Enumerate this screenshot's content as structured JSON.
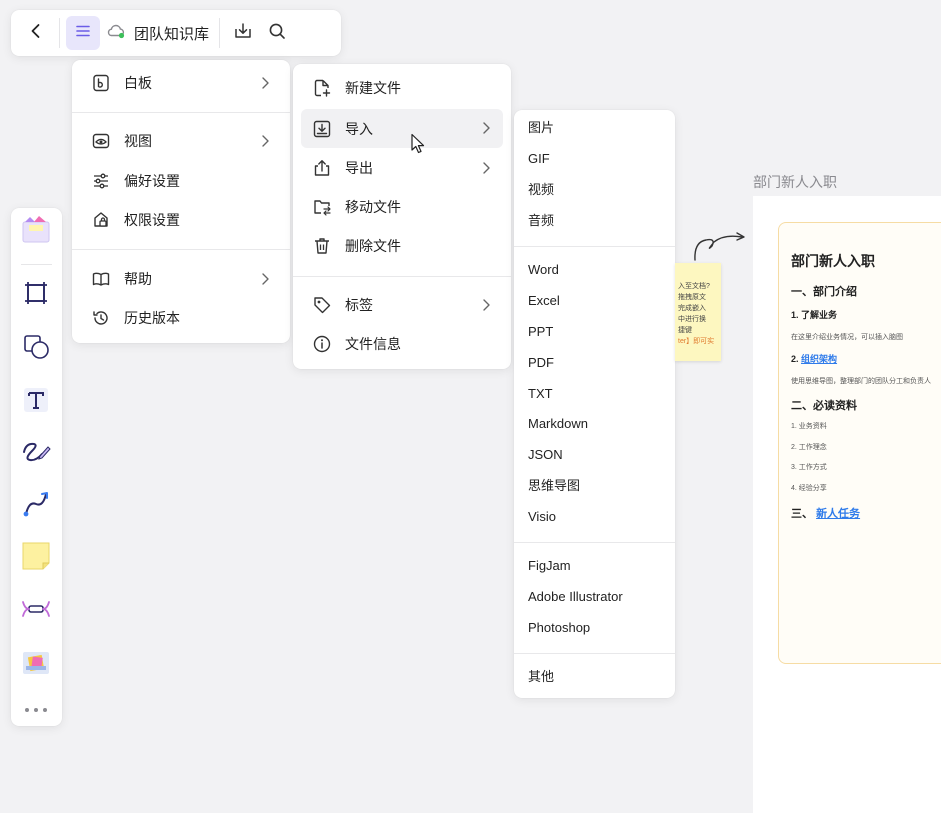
{
  "topbar": {
    "back_icon": "chevron-left-icon",
    "menu_icon": "hamburger-menu-icon",
    "cloud_icon": "cloud-synced-icon",
    "title": "团队知识库",
    "download_icon": "download-icon",
    "search_icon": "search-icon",
    "accent": "#6b5ce7"
  },
  "main_menu": {
    "items": [
      {
        "label": "白板",
        "icon": "whiteboard-icon",
        "has_submenu": true
      },
      {
        "label": "视图",
        "icon": "eye-icon",
        "has_submenu": true
      },
      {
        "label": "偏好设置",
        "icon": "sliders-icon",
        "has_submenu": false
      },
      {
        "label": "权限设置",
        "icon": "lock-icon",
        "has_submenu": false
      },
      {
        "label": "帮助",
        "icon": "book-icon",
        "has_submenu": true
      },
      {
        "label": "历史版本",
        "icon": "history-icon",
        "has_submenu": false
      }
    ]
  },
  "file_menu": {
    "items": [
      {
        "label": "新建文件",
        "icon": "new-file-icon",
        "has_submenu": false
      },
      {
        "label": "导入",
        "icon": "import-icon",
        "has_submenu": true,
        "active": true
      },
      {
        "label": "导出",
        "icon": "export-icon",
        "has_submenu": true
      },
      {
        "label": "移动文件",
        "icon": "move-folder-icon",
        "has_submenu": false
      },
      {
        "label": "删除文件",
        "icon": "trash-icon",
        "has_submenu": false
      },
      {
        "label": "标签",
        "icon": "tag-icon",
        "has_submenu": true
      },
      {
        "label": "文件信息",
        "icon": "info-icon",
        "has_submenu": false
      }
    ]
  },
  "import_menu": {
    "group1": [
      "图片",
      "GIF",
      "视频",
      "音频"
    ],
    "group2": [
      "Word",
      "Excel",
      "PPT",
      "PDF",
      "TXT",
      "Markdown",
      "JSON",
      "思维导图",
      "Visio"
    ],
    "group3": [
      "FigJam",
      "Adobe Illustrator",
      "Photoshop"
    ],
    "group4": [
      "其他"
    ]
  },
  "left_toolbar": {
    "tools": [
      "templates-icon",
      "frame-icon",
      "shape-icon",
      "text-icon",
      "pen-icon",
      "connector-icon",
      "sticky-note-icon",
      "mindmap-icon",
      "widgets-icon",
      "more-icon"
    ]
  },
  "canvas": {
    "board_label": "部门新人入职",
    "doc": {
      "title": "部门新人入职",
      "h1": "一、部门介绍",
      "h1_1": "1. 了解业务",
      "h1_1_text": "在这里介绍业务情况，可以插入脑图",
      "h1_2_prefix": "2.",
      "h1_2_link": "组织架构",
      "h1_2_text": "使用思维导图，整理部门的团队分工和负责人",
      "h2": "二、必读资料",
      "list": [
        "1. 业务资料",
        "2. 工作理念",
        "3. 工作方式",
        "4. 经验分享"
      ],
      "h3_prefix": "三、",
      "h3_link": "新人任务"
    },
    "sticky_lines": [
      "入至文档?",
      "拖拽原文",
      "完成嵌入",
      "中进行换",
      "捷键",
      "ter】即可实"
    ]
  }
}
